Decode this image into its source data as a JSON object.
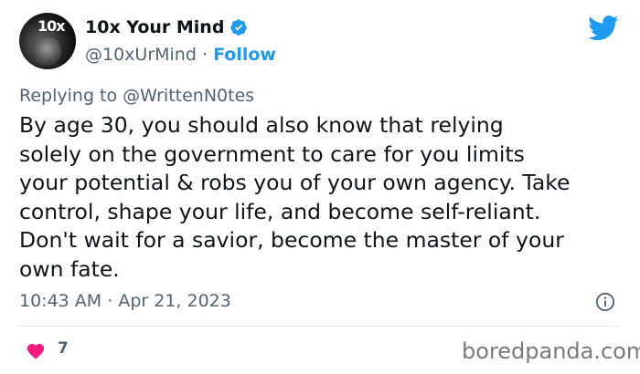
{
  "user": {
    "display_name": "10x Your Mind",
    "handle": "@10xUrMind",
    "separator": "·",
    "follow_label": "Follow",
    "avatar_text": "10x"
  },
  "reply": {
    "prefix": "Replying to",
    "mention": "@WrittenN0tes"
  },
  "tweet": {
    "text": "By age 30, you should also know that relying\nsolely on the government to care for you limits\nyour potential & robs you of your own agency. Take\ncontrol, shape your life, and become self-reliant.\nDon't wait for a savior, become the master of your\nown fate."
  },
  "meta": {
    "time": "10:43 AM",
    "separator": "·",
    "date": "Apr 21, 2023"
  },
  "engagement": {
    "like_count": "7"
  },
  "watermark": "boredpanda.com",
  "icons": {
    "verified": "verified-badge-icon",
    "twitter": "twitter-bird-icon",
    "info": "info-icon",
    "like": "heart-icon"
  },
  "colors": {
    "accent": "#1d9bf0",
    "heart": "#f91880",
    "secondary_text": "#536471"
  }
}
